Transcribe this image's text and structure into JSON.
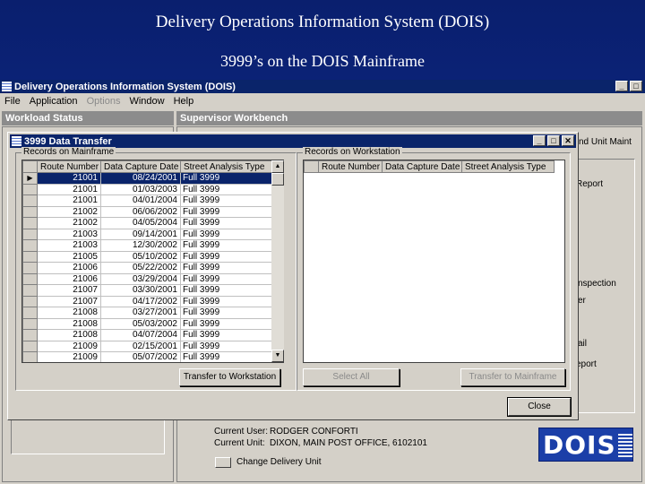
{
  "slide": {
    "title": "Delivery Operations Information System (DOIS)",
    "subtitle": "3999’s on the DOIS Mainframe"
  },
  "app": {
    "title": "Delivery Operations Information System (DOIS)",
    "menu": [
      "File",
      "Application",
      "Options",
      "Window",
      "Help"
    ],
    "workload_panel": "Workload Status",
    "supervisor_panel": "Supervisor Workbench",
    "bg_labels": [
      "nd Unit Maint",
      "Report",
      "nspection",
      "er",
      "ail",
      "eport"
    ],
    "current_user_label": "Current User:",
    "current_user": "RODGER CONFORTI",
    "current_unit_label": "Current Unit:",
    "current_unit": "DIXON, MAIN POST OFFICE, 6102101",
    "change_unit": "Change Delivery Unit",
    "logo_text": "DOIS"
  },
  "dialog": {
    "title": "3999 Data Transfer",
    "mainframe_group": "Records on Mainframe",
    "workstation_group": "Records on Workstation",
    "columns": [
      "Route Number",
      "Data Capture Date",
      "Street Analysis Type"
    ],
    "mainframe_rows": [
      [
        "21001",
        "08/24/2001",
        "Full 3999"
      ],
      [
        "21001",
        "01/03/2003",
        "Full 3999"
      ],
      [
        "21001",
        "04/01/2004",
        "Full 3999"
      ],
      [
        "21002",
        "06/06/2002",
        "Full 3999"
      ],
      [
        "21002",
        "04/05/2004",
        "Full 3999"
      ],
      [
        "21003",
        "09/14/2001",
        "Full 3999"
      ],
      [
        "21003",
        "12/30/2002",
        "Full 3999"
      ],
      [
        "21005",
        "05/10/2002",
        "Full 3999"
      ],
      [
        "21006",
        "05/22/2002",
        "Full 3999"
      ],
      [
        "21006",
        "03/29/2004",
        "Full 3999"
      ],
      [
        "21007",
        "03/30/2001",
        "Full 3999"
      ],
      [
        "21007",
        "04/17/2002",
        "Full 3999"
      ],
      [
        "21008",
        "03/27/2001",
        "Full 3999"
      ],
      [
        "21008",
        "05/03/2002",
        "Full 3999"
      ],
      [
        "21008",
        "04/07/2004",
        "Full 3999"
      ],
      [
        "21009",
        "02/15/2001",
        "Full 3999"
      ],
      [
        "21009",
        "05/07/2002",
        "Full 3999"
      ]
    ],
    "transfer_to_workstation": "Transfer to Workstation",
    "select_all": "Select All",
    "transfer_to_mainframe": "Transfer to Mainframe",
    "close": "Close"
  }
}
